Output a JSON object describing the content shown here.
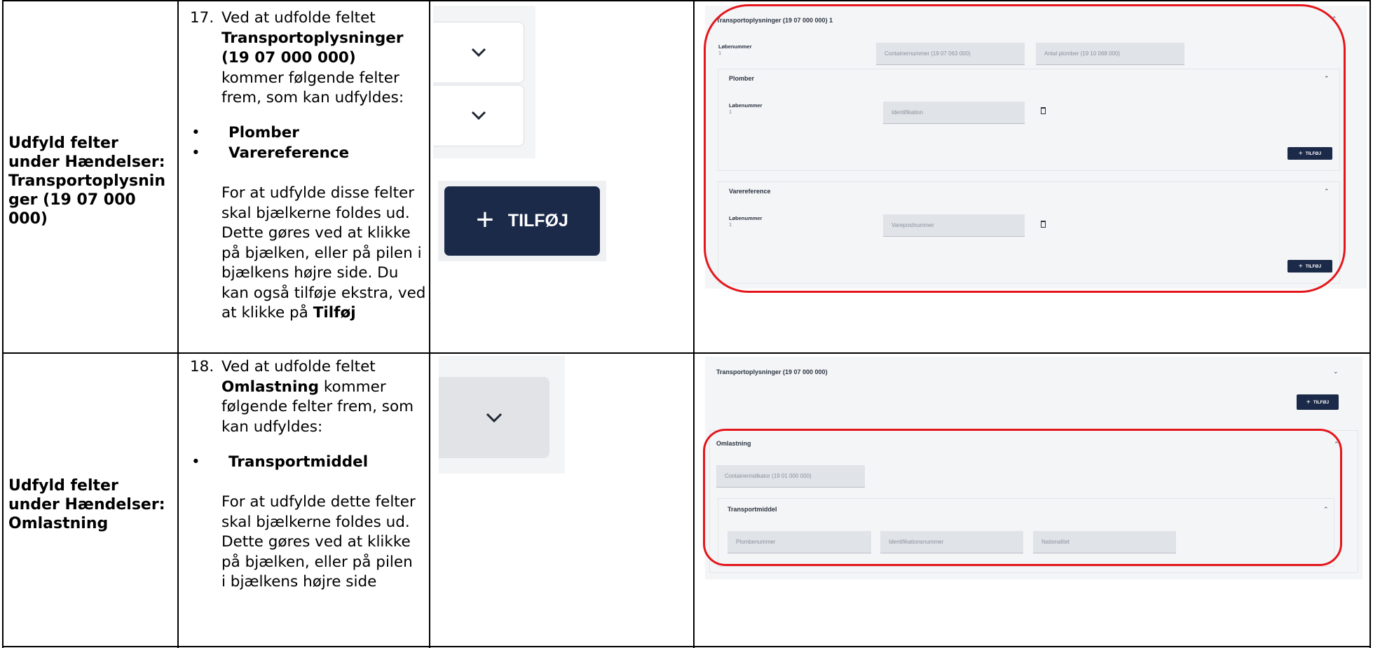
{
  "rows": [
    {
      "title": "Udfyld felter under Hændelser: Transportoplysnin ger (19 07 000 000)",
      "step_number": "17.",
      "intro_a": "Ved at udfolde feltet",
      "intro_bold": "Transportoplysninger (19 07 000 000)",
      "intro_b": "kommer følgende felter frem, som kan udfyldes:",
      "bullets": [
        "Plomber",
        "Varereference"
      ],
      "para": "For at udfylde disse felter skal bjælkerne foldes ud. Dette gøres ved at klikke på bjælken, eller på pilen i bjælkens højre side. Du kan også tilføje ekstra, ved at klikke på",
      "para_bold": "Tilføj",
      "add_button_label": "TILFØJ"
    },
    {
      "title": "Udfyld felter under Hændelser: Omlastning",
      "step_number": "18.",
      "intro_a": "Ved at udfolde feltet",
      "intro_bold": "Omlastning",
      "intro_b": "kommer følgende felter frem, som kan udfyldes:",
      "bullets": [
        "Transportmiddel"
      ],
      "para": "For at udfylde dette felter skal bjælkerne foldes ud. Dette gøres ved at klikke på bjælken, eller på pilen i bjælkens højre side"
    }
  ],
  "shot1": {
    "header": "Transportoplysninger (19 07 000 000) 1",
    "lob_label": "Løbenummer",
    "lob_value": "1",
    "container_field": "Containernummer (19 07 063 000)",
    "plomber_count_field": "Antal plomber (19 10 068 000)",
    "plomber_title": "Plomber",
    "plomber_lob_label": "Løbenummer",
    "plomber_lob_value": "1",
    "identifikation_field": "Identifikation",
    "add_label": "TILFØJ",
    "varereference_title": "Varereference",
    "vare_lob_label": "Løbenummer",
    "vare_lob_value": "1",
    "varepost_field": "Varepostnummer"
  },
  "shot2": {
    "header": "Transportoplysninger (19 07 000 000)",
    "add_label": "TILFØJ",
    "omlastning_title": "Omlastning",
    "containerindikator_field": "Containerindikator (19 01 000 000)",
    "transportmiddel_title": "Transportmiddel",
    "plombe_field": "Plombenummer",
    "ident_field": "Identifikationsnummer",
    "nationalitet_field": "Nationalitet"
  },
  "colors": {
    "button_navy": "#1c2a49",
    "highlight_red": "#e4161b",
    "panel_grey": "#f4f5f7",
    "field_grey": "#e0e3e8"
  }
}
